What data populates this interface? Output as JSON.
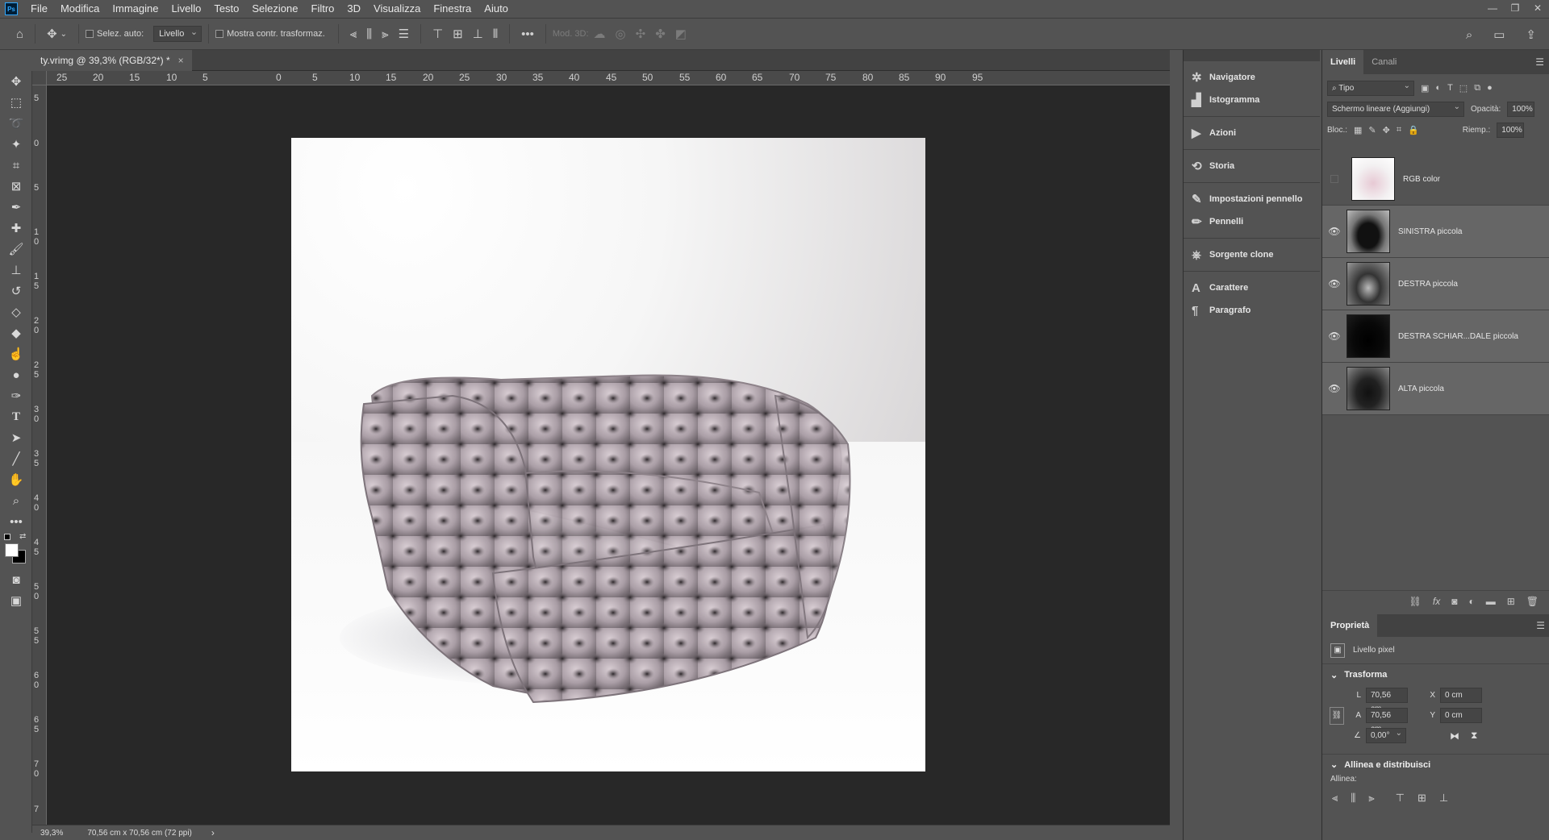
{
  "menu": {
    "items": [
      "File",
      "Modifica",
      "Immagine",
      "Livello",
      "Testo",
      "Selezione",
      "Filtro",
      "3D",
      "Visualizza",
      "Finestra",
      "Aiuto"
    ]
  },
  "options": {
    "auto_select_label": "Selez. auto:",
    "auto_select_target": "Livello",
    "show_transform_label": "Mostra contr. trasformaz.",
    "mode_3d_label": "Mod. 3D:"
  },
  "document": {
    "tab_title": "ty.vrimg @ 39,3% (RGB/32*) *",
    "close_glyph": "×"
  },
  "rulers": {
    "horizontal": [
      "25",
      "20",
      "15",
      "10",
      "5",
      "0",
      "5",
      "10",
      "15",
      "20",
      "25",
      "30",
      "35",
      "40",
      "45",
      "50",
      "55",
      "60",
      "65",
      "70",
      "75",
      "80",
      "85",
      "90",
      "95"
    ],
    "vertical": [
      "5",
      "0",
      "5",
      "1 0",
      "1 5",
      "2 0",
      "2 5",
      "3 0",
      "3 5",
      "4 0",
      "4 5",
      "5 0",
      "5 5",
      "6 0",
      "6 5",
      "7 0",
      "7"
    ]
  },
  "status": {
    "zoom": "39,3%",
    "doc_size": "70,56 cm x 70,56 cm (72 ppi)",
    "arrow": "›"
  },
  "dock": {
    "groups": [
      {
        "items": [
          {
            "icon": "navigator-icon",
            "glyph": "✲",
            "label": "Navigatore"
          },
          {
            "icon": "histogram-icon",
            "glyph": "▟",
            "label": "Istogramma"
          }
        ]
      },
      {
        "items": [
          {
            "icon": "actions-icon",
            "glyph": "▶",
            "label": "Azioni"
          }
        ]
      },
      {
        "items": [
          {
            "icon": "history-icon",
            "glyph": "⟲",
            "label": "Storia"
          }
        ]
      },
      {
        "items": [
          {
            "icon": "brush-settings-icon",
            "glyph": "✎",
            "label": "Impostazioni pennello"
          },
          {
            "icon": "brushes-icon",
            "glyph": "✏",
            "label": "Pennelli"
          }
        ]
      },
      {
        "items": [
          {
            "icon": "clone-source-icon",
            "glyph": "⎈",
            "label": "Sorgente clone"
          }
        ]
      },
      {
        "items": [
          {
            "icon": "character-icon",
            "glyph": "A",
            "label": "Carattere"
          },
          {
            "icon": "paragraph-icon",
            "glyph": "¶",
            "label": "Paragrafo"
          }
        ]
      }
    ]
  },
  "layers_panel": {
    "tabs": [
      "Livelli",
      "Canali"
    ],
    "filter": "Tipo",
    "blend_mode": "Schermo lineare (Aggiungi)",
    "opacity_label": "Opacità:",
    "opacity": "100%",
    "lock_label": "Bloc.:",
    "fill_label": "Riemp.:",
    "fill": "100%",
    "layers": [
      {
        "name": "RGB color",
        "visible": false,
        "selected": false
      },
      {
        "name": "SINISTRA piccola",
        "visible": true,
        "selected": true
      },
      {
        "name": "DESTRA piccola",
        "visible": true,
        "selected": true
      },
      {
        "name": "DESTRA SCHIAR...DALE piccola",
        "visible": true,
        "selected": true
      },
      {
        "name": "ALTA piccola",
        "visible": true,
        "selected": true
      }
    ]
  },
  "properties": {
    "tab": "Proprietà",
    "type": "Livello pixel",
    "transform_title": "Trasforma",
    "L_label": "L",
    "L": "70,56 cm",
    "A_label": "A",
    "A": "70,56 cm",
    "X_label": "X",
    "X": "0 cm",
    "Y_label": "Y",
    "Y": "0 cm",
    "angle": "0,00°",
    "align_title": "Allinea e distribuisci",
    "align_label": "Allinea:"
  },
  "colors": {
    "bg": "#535353",
    "canvas_bg": "#282828",
    "selected_layer": "#666666"
  }
}
